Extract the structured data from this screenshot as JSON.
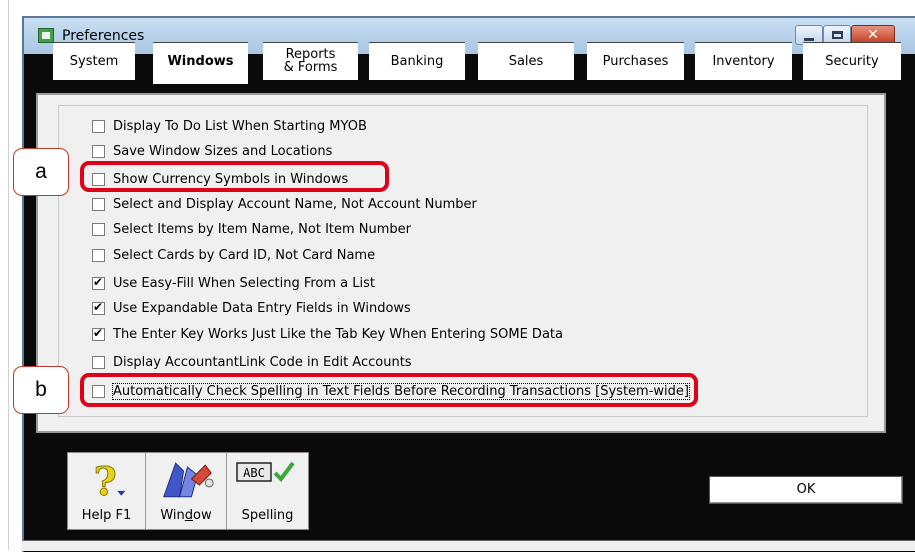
{
  "window": {
    "title": "Preferences",
    "close_glyph": "✕"
  },
  "tabs": [
    {
      "label": "System",
      "active": false
    },
    {
      "label": "Windows",
      "active": true
    },
    {
      "label": "Reports & Forms",
      "line1": "Reports",
      "line2": "& Forms",
      "active": false
    },
    {
      "label": "Banking",
      "active": false
    },
    {
      "label": "Sales",
      "active": false
    },
    {
      "label": "Purchases",
      "active": false
    },
    {
      "label": "Inventory",
      "active": false
    },
    {
      "label": "Security",
      "active": false
    }
  ],
  "options": [
    {
      "label": "Display To Do List When Starting MYOB",
      "checked": false
    },
    {
      "label": "Save Window Sizes and Locations",
      "checked": false
    },
    {
      "label": "Show Currency Symbols in Windows",
      "checked": false
    },
    {
      "label": "Select and Display Account Name, Not Account Number",
      "checked": false
    },
    {
      "label": "Select Items by Item Name, Not Item Number",
      "checked": false
    },
    {
      "label": "Select Cards by Card ID, Not Card Name",
      "checked": false
    },
    {
      "label": "Use Easy-Fill When Selecting From a List",
      "checked": true
    },
    {
      "label": "Use Expandable Data Entry Fields in Windows",
      "checked": true
    },
    {
      "label": "The Enter Key Works Just Like the Tab Key When Entering SOME Data",
      "checked": true
    },
    {
      "label": "Display AccountantLink Code in Edit Accounts",
      "checked": false
    },
    {
      "label": "Automatically Check Spelling in Text Fields Before Recording Transactions [System-wide]",
      "checked": false
    }
  ],
  "annotations": [
    {
      "letter": "a"
    },
    {
      "letter": "b"
    }
  ],
  "toolbar": {
    "help_label": "Help F1",
    "window_label": "Window",
    "spelling_label": "Spelling",
    "abc_text": "ABC"
  },
  "buttons": {
    "ok_label": "OK"
  },
  "colors": {
    "highlight": "#e0001a",
    "titlebar": "#b7d0ea",
    "panel": "#f0f0f0",
    "checkmark": "#3aa83a"
  }
}
